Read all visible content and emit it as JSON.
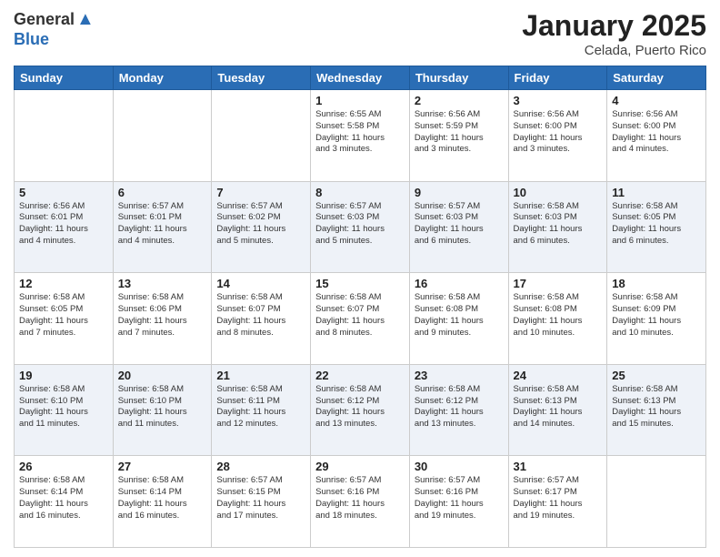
{
  "header": {
    "logo_general": "General",
    "logo_blue": "Blue",
    "month": "January 2025",
    "location": "Celada, Puerto Rico"
  },
  "days_of_week": [
    "Sunday",
    "Monday",
    "Tuesday",
    "Wednesday",
    "Thursday",
    "Friday",
    "Saturday"
  ],
  "weeks": [
    [
      {
        "day": "",
        "info": ""
      },
      {
        "day": "",
        "info": ""
      },
      {
        "day": "",
        "info": ""
      },
      {
        "day": "1",
        "info": "Sunrise: 6:55 AM\nSunset: 5:58 PM\nDaylight: 11 hours\nand 3 minutes."
      },
      {
        "day": "2",
        "info": "Sunrise: 6:56 AM\nSunset: 5:59 PM\nDaylight: 11 hours\nand 3 minutes."
      },
      {
        "day": "3",
        "info": "Sunrise: 6:56 AM\nSunset: 6:00 PM\nDaylight: 11 hours\nand 3 minutes."
      },
      {
        "day": "4",
        "info": "Sunrise: 6:56 AM\nSunset: 6:00 PM\nDaylight: 11 hours\nand 4 minutes."
      }
    ],
    [
      {
        "day": "5",
        "info": "Sunrise: 6:56 AM\nSunset: 6:01 PM\nDaylight: 11 hours\nand 4 minutes."
      },
      {
        "day": "6",
        "info": "Sunrise: 6:57 AM\nSunset: 6:01 PM\nDaylight: 11 hours\nand 4 minutes."
      },
      {
        "day": "7",
        "info": "Sunrise: 6:57 AM\nSunset: 6:02 PM\nDaylight: 11 hours\nand 5 minutes."
      },
      {
        "day": "8",
        "info": "Sunrise: 6:57 AM\nSunset: 6:03 PM\nDaylight: 11 hours\nand 5 minutes."
      },
      {
        "day": "9",
        "info": "Sunrise: 6:57 AM\nSunset: 6:03 PM\nDaylight: 11 hours\nand 6 minutes."
      },
      {
        "day": "10",
        "info": "Sunrise: 6:58 AM\nSunset: 6:03 PM\nDaylight: 11 hours\nand 6 minutes."
      },
      {
        "day": "11",
        "info": "Sunrise: 6:58 AM\nSunset: 6:05 PM\nDaylight: 11 hours\nand 6 minutes."
      }
    ],
    [
      {
        "day": "12",
        "info": "Sunrise: 6:58 AM\nSunset: 6:05 PM\nDaylight: 11 hours\nand 7 minutes."
      },
      {
        "day": "13",
        "info": "Sunrise: 6:58 AM\nSunset: 6:06 PM\nDaylight: 11 hours\nand 7 minutes."
      },
      {
        "day": "14",
        "info": "Sunrise: 6:58 AM\nSunset: 6:07 PM\nDaylight: 11 hours\nand 8 minutes."
      },
      {
        "day": "15",
        "info": "Sunrise: 6:58 AM\nSunset: 6:07 PM\nDaylight: 11 hours\nand 8 minutes."
      },
      {
        "day": "16",
        "info": "Sunrise: 6:58 AM\nSunset: 6:08 PM\nDaylight: 11 hours\nand 9 minutes."
      },
      {
        "day": "17",
        "info": "Sunrise: 6:58 AM\nSunset: 6:08 PM\nDaylight: 11 hours\nand 10 minutes."
      },
      {
        "day": "18",
        "info": "Sunrise: 6:58 AM\nSunset: 6:09 PM\nDaylight: 11 hours\nand 10 minutes."
      }
    ],
    [
      {
        "day": "19",
        "info": "Sunrise: 6:58 AM\nSunset: 6:10 PM\nDaylight: 11 hours\nand 11 minutes."
      },
      {
        "day": "20",
        "info": "Sunrise: 6:58 AM\nSunset: 6:10 PM\nDaylight: 11 hours\nand 11 minutes."
      },
      {
        "day": "21",
        "info": "Sunrise: 6:58 AM\nSunset: 6:11 PM\nDaylight: 11 hours\nand 12 minutes."
      },
      {
        "day": "22",
        "info": "Sunrise: 6:58 AM\nSunset: 6:12 PM\nDaylight: 11 hours\nand 13 minutes."
      },
      {
        "day": "23",
        "info": "Sunrise: 6:58 AM\nSunset: 6:12 PM\nDaylight: 11 hours\nand 13 minutes."
      },
      {
        "day": "24",
        "info": "Sunrise: 6:58 AM\nSunset: 6:13 PM\nDaylight: 11 hours\nand 14 minutes."
      },
      {
        "day": "25",
        "info": "Sunrise: 6:58 AM\nSunset: 6:13 PM\nDaylight: 11 hours\nand 15 minutes."
      }
    ],
    [
      {
        "day": "26",
        "info": "Sunrise: 6:58 AM\nSunset: 6:14 PM\nDaylight: 11 hours\nand 16 minutes."
      },
      {
        "day": "27",
        "info": "Sunrise: 6:58 AM\nSunset: 6:14 PM\nDaylight: 11 hours\nand 16 minutes."
      },
      {
        "day": "28",
        "info": "Sunrise: 6:57 AM\nSunset: 6:15 PM\nDaylight: 11 hours\nand 17 minutes."
      },
      {
        "day": "29",
        "info": "Sunrise: 6:57 AM\nSunset: 6:16 PM\nDaylight: 11 hours\nand 18 minutes."
      },
      {
        "day": "30",
        "info": "Sunrise: 6:57 AM\nSunset: 6:16 PM\nDaylight: 11 hours\nand 19 minutes."
      },
      {
        "day": "31",
        "info": "Sunrise: 6:57 AM\nSunset: 6:17 PM\nDaylight: 11 hours\nand 19 minutes."
      },
      {
        "day": "",
        "info": ""
      }
    ]
  ]
}
